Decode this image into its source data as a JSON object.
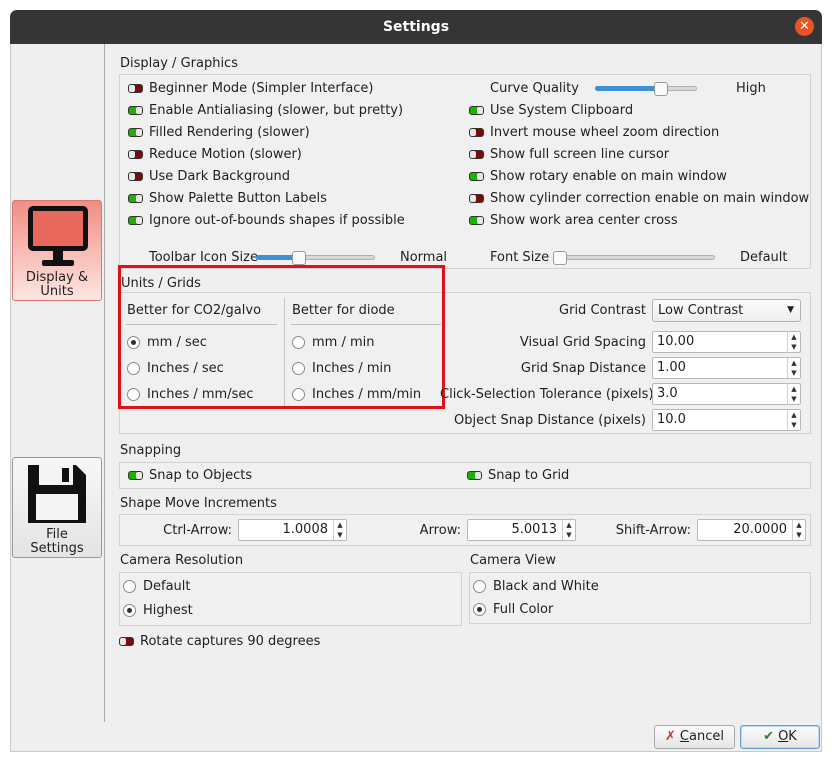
{
  "window": {
    "title": "Settings",
    "close_glyph": "✕"
  },
  "sidebar": {
    "items": [
      {
        "label_line1": "Display &",
        "label_line2": "Units",
        "icon": "monitor-icon",
        "active": true
      },
      {
        "label_line1": "File",
        "label_line2": "Settings",
        "icon": "floppy-disk-icon",
        "active": false
      }
    ]
  },
  "display": {
    "section_title": "Display / Graphics",
    "left_options": [
      {
        "label": "Beginner Mode (Simpler Interface)",
        "on": false
      },
      {
        "label": "Enable Antialiasing (slower, but pretty)",
        "on": true
      },
      {
        "label": "Filled Rendering (slower)",
        "on": true
      },
      {
        "label": "Reduce Motion (slower)",
        "on": false
      },
      {
        "label": "Use Dark Background",
        "on": false
      },
      {
        "label": "Show Palette Button Labels",
        "on": true
      },
      {
        "label": "Ignore out-of-bounds shapes if possible",
        "on": true
      }
    ],
    "curve_quality": {
      "label": "Curve Quality",
      "value_label": "High",
      "level": 0.68
    },
    "right_options": [
      {
        "label": "Use System Clipboard",
        "on": true
      },
      {
        "label": "Invert mouse wheel zoom direction",
        "on": false
      },
      {
        "label": "Show full screen line cursor",
        "on": false
      },
      {
        "label": "Show rotary enable on main window",
        "on": true
      },
      {
        "label": "Show cylinder correction enable on main window",
        "on": false
      },
      {
        "label": "Show work area center cross",
        "on": true
      }
    ],
    "toolbar_icon_size": {
      "label": "Toolbar Icon Size",
      "value_label": "Normal",
      "level": 0.35
    },
    "font_size": {
      "label": "Font Size",
      "value_label": "Default",
      "level": 0.0
    }
  },
  "units": {
    "section_title": "Units / Grids",
    "co2": {
      "header": "Better for CO2/galvo",
      "options": [
        "mm / sec",
        "Inches / sec",
        "Inches / mm/sec"
      ],
      "selected": 0
    },
    "diode": {
      "header": "Better for diode",
      "options": [
        "mm / min",
        "Inches / min",
        "Inches / mm/min"
      ],
      "selected": -1
    },
    "grid_contrast": {
      "label": "Grid Contrast",
      "value": "Low Contrast"
    },
    "visual_grid_spacing": {
      "label": "Visual Grid Spacing",
      "value": "10.00"
    },
    "grid_snap_distance": {
      "label": "Grid Snap Distance",
      "value": "1.00"
    },
    "click_selection_tolerance": {
      "label": "Click-Selection Tolerance (pixels)",
      "value": "3.0"
    },
    "object_snap_distance": {
      "label": "Object Snap Distance (pixels)",
      "value": "10.0"
    }
  },
  "snapping": {
    "section_title": "Snapping",
    "snap_to_objects": {
      "label": "Snap to Objects",
      "on": true
    },
    "snap_to_grid": {
      "label": "Snap to Grid",
      "on": true
    }
  },
  "move_increments": {
    "section_title": "Shape Move Increments",
    "ctrl_arrow": {
      "label": "Ctrl-Arrow:",
      "value": "1.0008"
    },
    "arrow": {
      "label": "Arrow:",
      "value": "5.0013"
    },
    "shift_arrow": {
      "label": "Shift-Arrow:",
      "value": "20.0000"
    }
  },
  "camera_resolution": {
    "section_title": "Camera Resolution",
    "options": [
      "Default",
      "Highest"
    ],
    "selected": 1
  },
  "camera_view": {
    "section_title": "Camera View",
    "options": [
      "Black and White",
      "Full Color"
    ],
    "selected": 1
  },
  "rotate_captures": {
    "label": "Rotate captures 90 degrees",
    "on": false
  },
  "buttons": {
    "cancel_label": "Cancel",
    "cancel_mnemonic": "C",
    "cancel_rest": "ancel",
    "ok_label": "OK",
    "ok_mnemonic": "O",
    "ok_rest": "K"
  },
  "colors": {
    "accent": "#e95420",
    "toggle_on": "#1db100",
    "toggle_off": "#7b0a0a",
    "highlight": "#e3101b",
    "sidebar_active": "#f28d85"
  }
}
